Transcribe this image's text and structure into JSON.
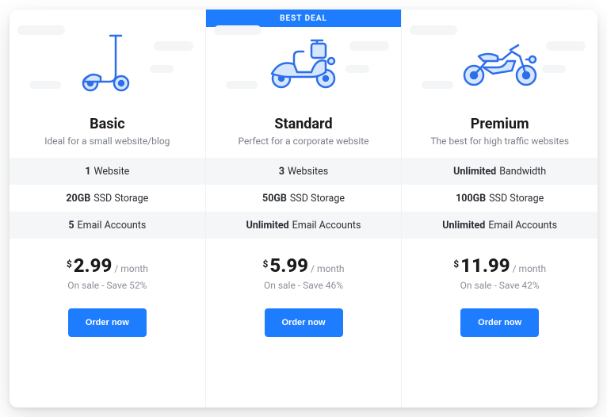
{
  "badge": "BEST DEAL",
  "plans": [
    {
      "icon": "scooter-icon",
      "name": "Basic",
      "tagline": "Ideal for a small website/blog",
      "feat1_b": "1",
      "feat1_r": "Website",
      "feat2_b": "20GB",
      "feat2_r": "SSD Storage",
      "feat3_b": "5",
      "feat3_r": "Email Accounts",
      "currency": "$",
      "amount": "2.99",
      "period": "/ month",
      "sale": "On sale - Save 52%",
      "cta": "Order now"
    },
    {
      "icon": "moped-icon",
      "name": "Standard",
      "tagline": "Perfect for a corporate website",
      "feat1_b": "3",
      "feat1_r": "Websites",
      "feat2_b": "50GB",
      "feat2_r": "SSD Storage",
      "feat3_b": "Unlimited",
      "feat3_r": "Email Accounts",
      "currency": "$",
      "amount": "5.99",
      "period": "/ month",
      "sale": "On sale - Save 46%",
      "cta": "Order now"
    },
    {
      "icon": "motorcycle-icon",
      "name": "Premium",
      "tagline": "The best for high traffic websites",
      "feat1_b": "Unlimited",
      "feat1_r": "Bandwidth",
      "feat2_b": "100GB",
      "feat2_r": "SSD Storage",
      "feat3_b": "Unlimited",
      "feat3_r": "Email Accounts",
      "currency": "$",
      "amount": "11.99",
      "period": "/ month",
      "sale": "On sale - Save 42%",
      "cta": "Order now"
    }
  ]
}
